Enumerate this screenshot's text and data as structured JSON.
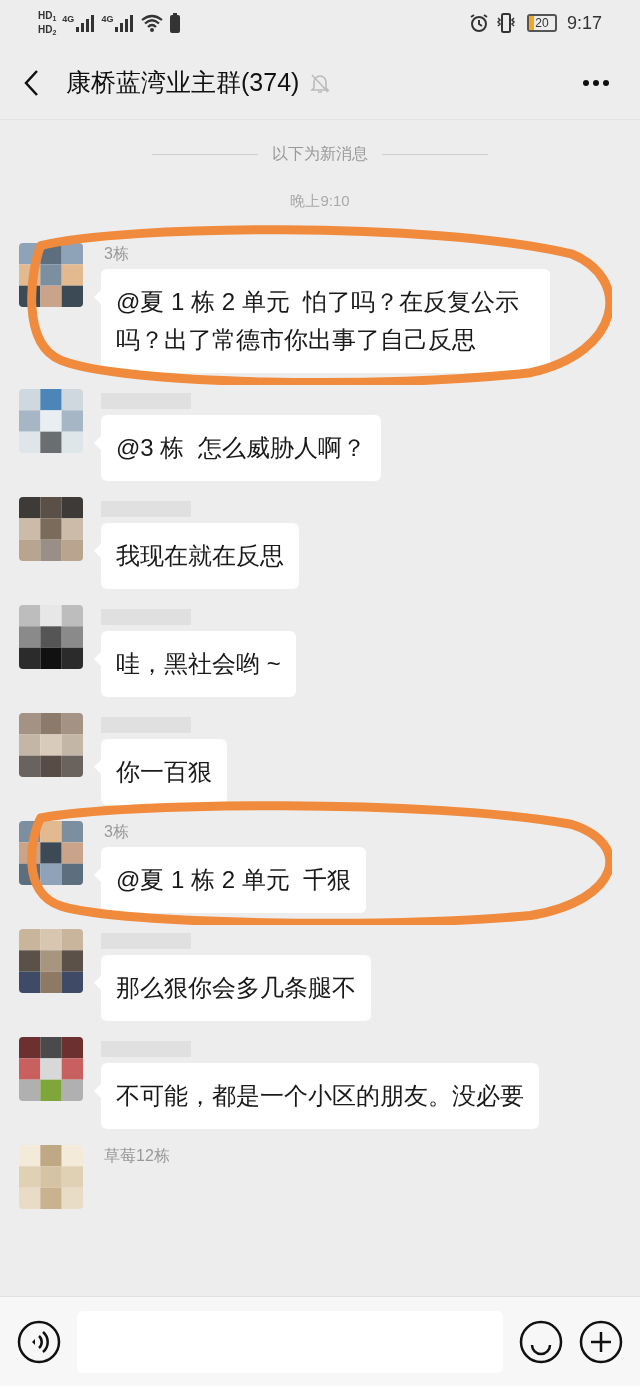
{
  "status_bar": {
    "sims": [
      {
        "label": "HD",
        "slot": "1",
        "network": "4G"
      },
      {
        "label": "HD",
        "slot": "2",
        "network": "4G"
      }
    ],
    "battery": "20",
    "time": "9:17"
  },
  "header": {
    "title": "康桥蓝湾业主群(374)",
    "muted": true
  },
  "divider": "以下为新消息",
  "timestamp": "晚上9:10",
  "messages": [
    {
      "sender": "3栋",
      "text": "@夏 1 栋 2 单元  怕了吗？在反复公示吗？出了常德市你出事了自己反思",
      "circled": true
    },
    {
      "text": "@3 栋  怎么威胁人啊？",
      "circled": false
    },
    {
      "text": "我现在就在反思",
      "circled": false
    },
    {
      "text": "哇，黑社会哟 ~",
      "circled": false
    },
    {
      "text": "你一百狠",
      "circled": false
    },
    {
      "sender": "3栋",
      "text": "@夏 1 栋 2 单元  千狠",
      "circled": true
    },
    {
      "text": "那么狠你会多几条腿不",
      "circled": false
    },
    {
      "text": "不可能，都是一个小区的朋友。没必要",
      "circled": false
    },
    {
      "sender": "草莓12栋",
      "circled": false
    }
  ]
}
